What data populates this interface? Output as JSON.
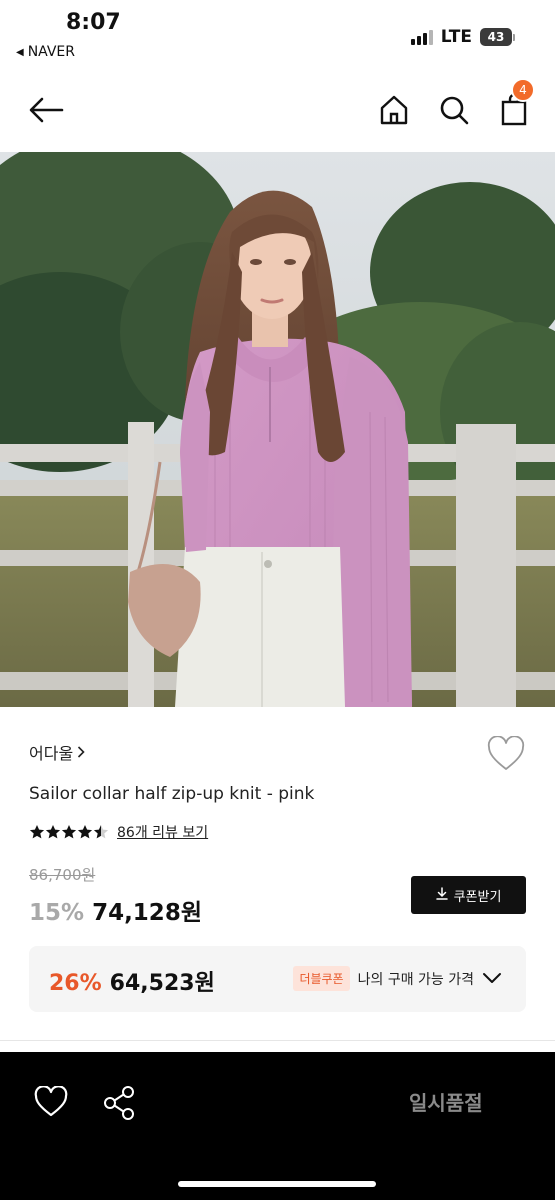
{
  "status_bar": {
    "time": "8:07",
    "back_app": "NAVER",
    "network": "LTE",
    "battery": "43"
  },
  "header": {
    "icons": [
      "back-arrow-icon",
      "home-icon",
      "search-icon",
      "shopping-bag-icon"
    ],
    "cart_count": "4",
    "accent_color": "#f26b2a"
  },
  "product": {
    "brand": "어다울",
    "name": "Sailor collar half zip-up knit - pink",
    "rating_stars": 4.5,
    "review_link": "86개 리뷰 보기",
    "original_price": "86,700원",
    "discount": "15%",
    "price": "74,128원",
    "coupon_button": "쿠폰받기"
  },
  "double_coupon": {
    "discount": "26%",
    "price": "64,523원",
    "badge": "더블쿠폰",
    "label": "나의 구매 가능 가격",
    "accent_color": "#e8582a"
  },
  "bottom_bar": {
    "icons": [
      "heart-icon",
      "share-icon"
    ],
    "status": "일시품절"
  }
}
